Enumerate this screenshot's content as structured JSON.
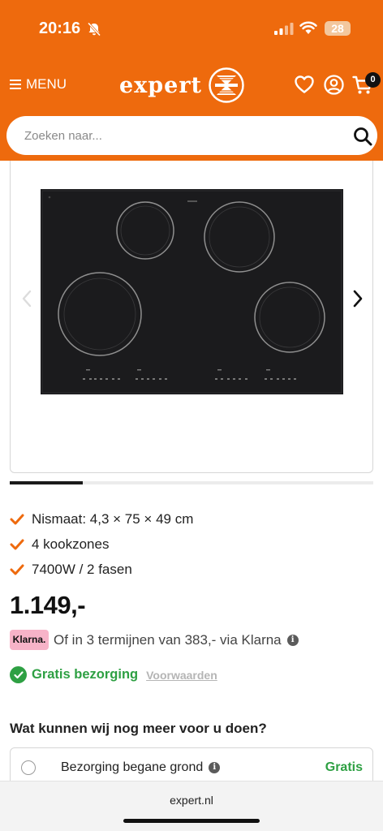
{
  "status": {
    "time": "20:16",
    "battery": "28"
  },
  "header": {
    "menu_label": "MENU",
    "logo_text": "expert",
    "cart_count": "0",
    "brand_color": "#ee6a0d"
  },
  "search": {
    "placeholder": "Zoeken naar..."
  },
  "gallery": {
    "progress": 0.2
  },
  "features": [
    "Nismaat: 4,3 × 75 × 49 cm",
    "4 kookzones",
    "7400W / 2 fasen"
  ],
  "price": "1.149,-",
  "klarna": {
    "badge": "Klarna.",
    "text": "Of in 3 termijnen van 383,- via Klarna"
  },
  "delivery": {
    "label": "Gratis bezorging",
    "conditions_link": "Voorwaarden"
  },
  "services": {
    "heading": "Wat kunnen wij nog meer voor u doen?",
    "options": [
      {
        "label": "Bezorging begane grond",
        "price": "Gratis"
      }
    ]
  },
  "browser": {
    "url": "expert.nl"
  },
  "icons": {
    "bell": "bell-slash-icon",
    "signal": "signal-icon",
    "wifi": "wifi-icon",
    "favorites": "heart-icon",
    "account": "user-icon",
    "cart": "cart-icon",
    "search": "search-icon",
    "check": "check-icon",
    "info": "info-icon"
  }
}
